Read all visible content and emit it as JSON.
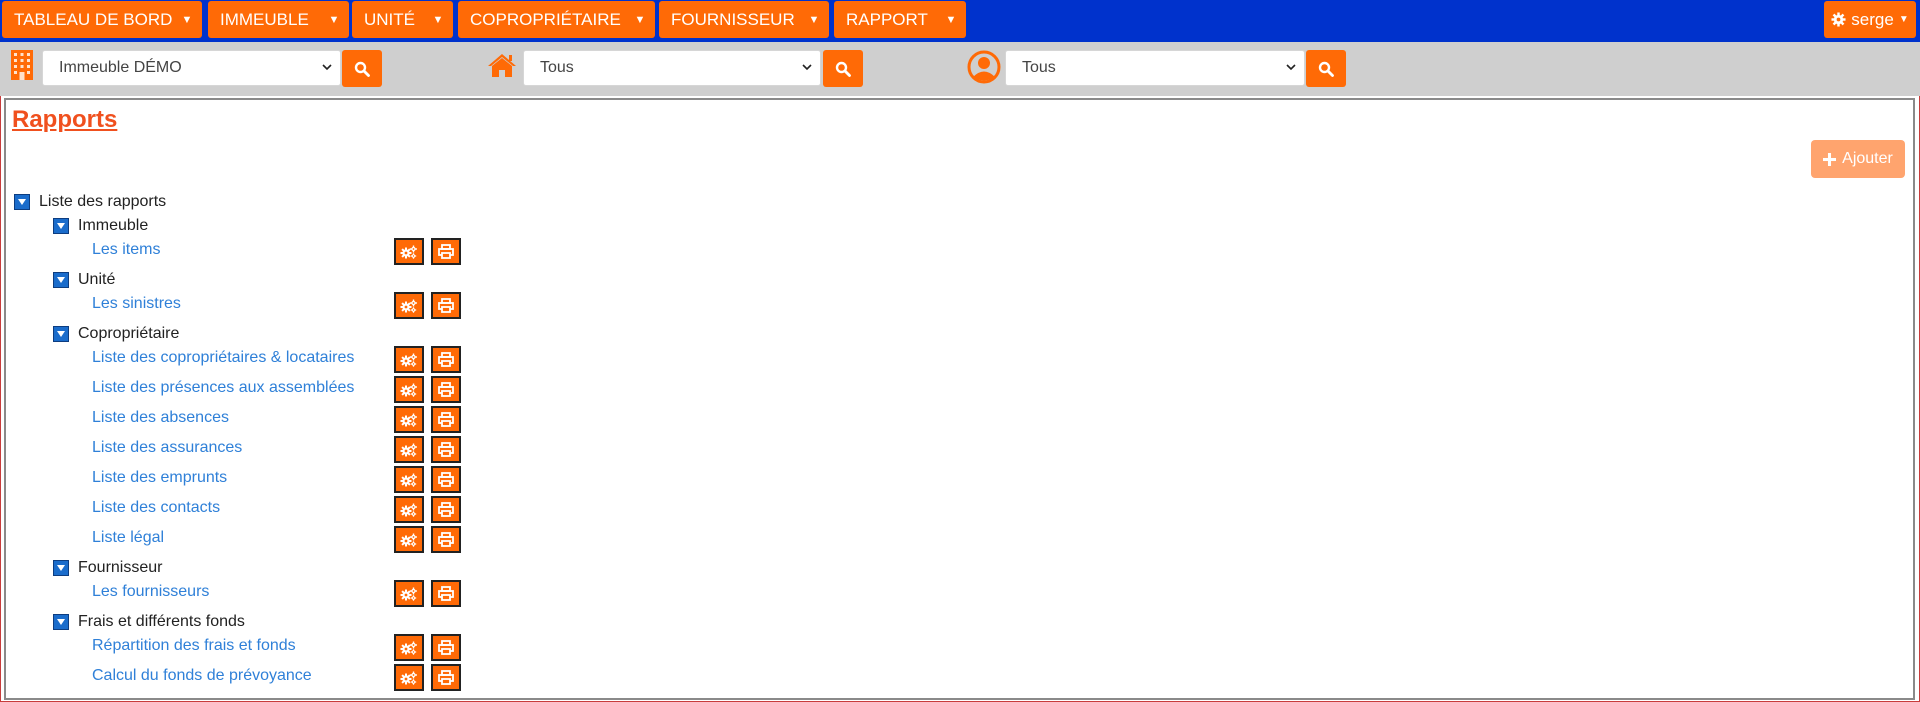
{
  "nav": {
    "items": [
      {
        "label": "TABLEAU DE BORD"
      },
      {
        "label": "IMMEUBLE"
      },
      {
        "label": "UNITÉ"
      },
      {
        "label": "COPROPRIÉTAIRE"
      },
      {
        "label": "FOURNISSEUR"
      },
      {
        "label": "RAPPORT"
      }
    ],
    "user": "serge"
  },
  "filters": {
    "building": "Immeuble DÉMO",
    "unit": "Tous",
    "owner": "Tous"
  },
  "page": {
    "title": "Rapports",
    "add_label": "Ajouter"
  },
  "tree": {
    "root": "Liste des rapports",
    "groups": [
      {
        "label": "Immeuble",
        "items": [
          "Les items"
        ]
      },
      {
        "label": "Unité",
        "items": [
          "Les sinistres"
        ]
      },
      {
        "label": "Copropriétaire",
        "items": [
          "Liste des copropriétaires & locataires",
          "Liste des présences aux assemblées",
          "Liste des absences",
          "Liste des assurances",
          "Liste des emprunts",
          "Liste des contacts",
          "Liste légal"
        ]
      },
      {
        "label": "Fournisseur",
        "items": [
          "Les fournisseurs"
        ]
      },
      {
        "label": "Frais et différents fonds",
        "items": [
          "Répartition des frais et fonds",
          "Calcul du fonds de prévoyance"
        ]
      }
    ]
  },
  "colors": {
    "nav_bg": "#0032cc",
    "accent": "#ff6a06",
    "title": "#f0501e",
    "link": "#2f80d8"
  }
}
